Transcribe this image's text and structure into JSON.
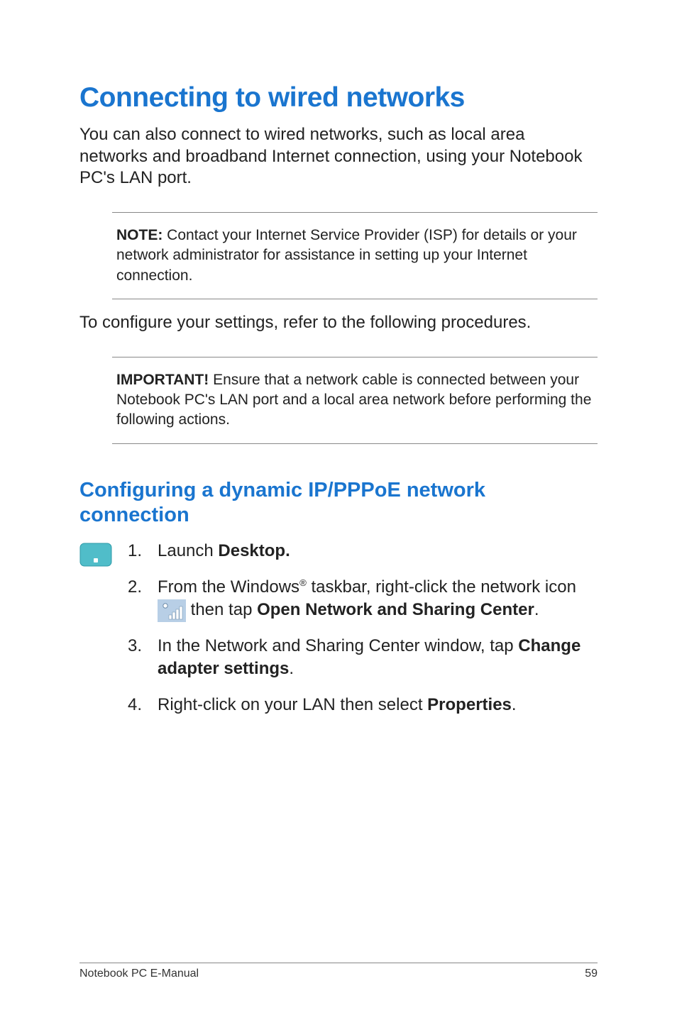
{
  "title": "Connecting to wired networks",
  "intro": "You can also connect to wired networks, such as local area networks and broadband Internet connection, using your Notebook PC's LAN port.",
  "note_label": "NOTE:",
  "note_body": " Contact your Internet Service Provider (ISP) for details or your network administrator for assistance in setting up your Internet connection.",
  "configure_line": "To configure your settings, refer to the following procedures.",
  "important_label": "IMPORTANT!",
  "important_body": "  Ensure that a network cable is connected between your Notebook PC's LAN port and a local area network before performing the following actions.",
  "subtitle": "Configuring a dynamic IP/PPPoE network connection",
  "steps": {
    "s1": {
      "num": "1.",
      "pre": "Launch ",
      "bold": "Desktop."
    },
    "s2": {
      "num": "2.",
      "pre": "From the Windows",
      "sup": "®",
      "mid": " taskbar, right-click the network icon ",
      "post": " then tap ",
      "bold1": "Open Network and Sharing Center",
      "tail": "."
    },
    "s3": {
      "num": "3.",
      "pre": "In the Network and Sharing Center window, tap ",
      "bold": "Change adapter settings",
      "tail": "."
    },
    "s4": {
      "num": "4.",
      "pre": "Right-click on your LAN then select ",
      "bold": "Properties",
      "tail": "."
    }
  },
  "footer_left": "Notebook PC E-Manual",
  "footer_right": "59"
}
